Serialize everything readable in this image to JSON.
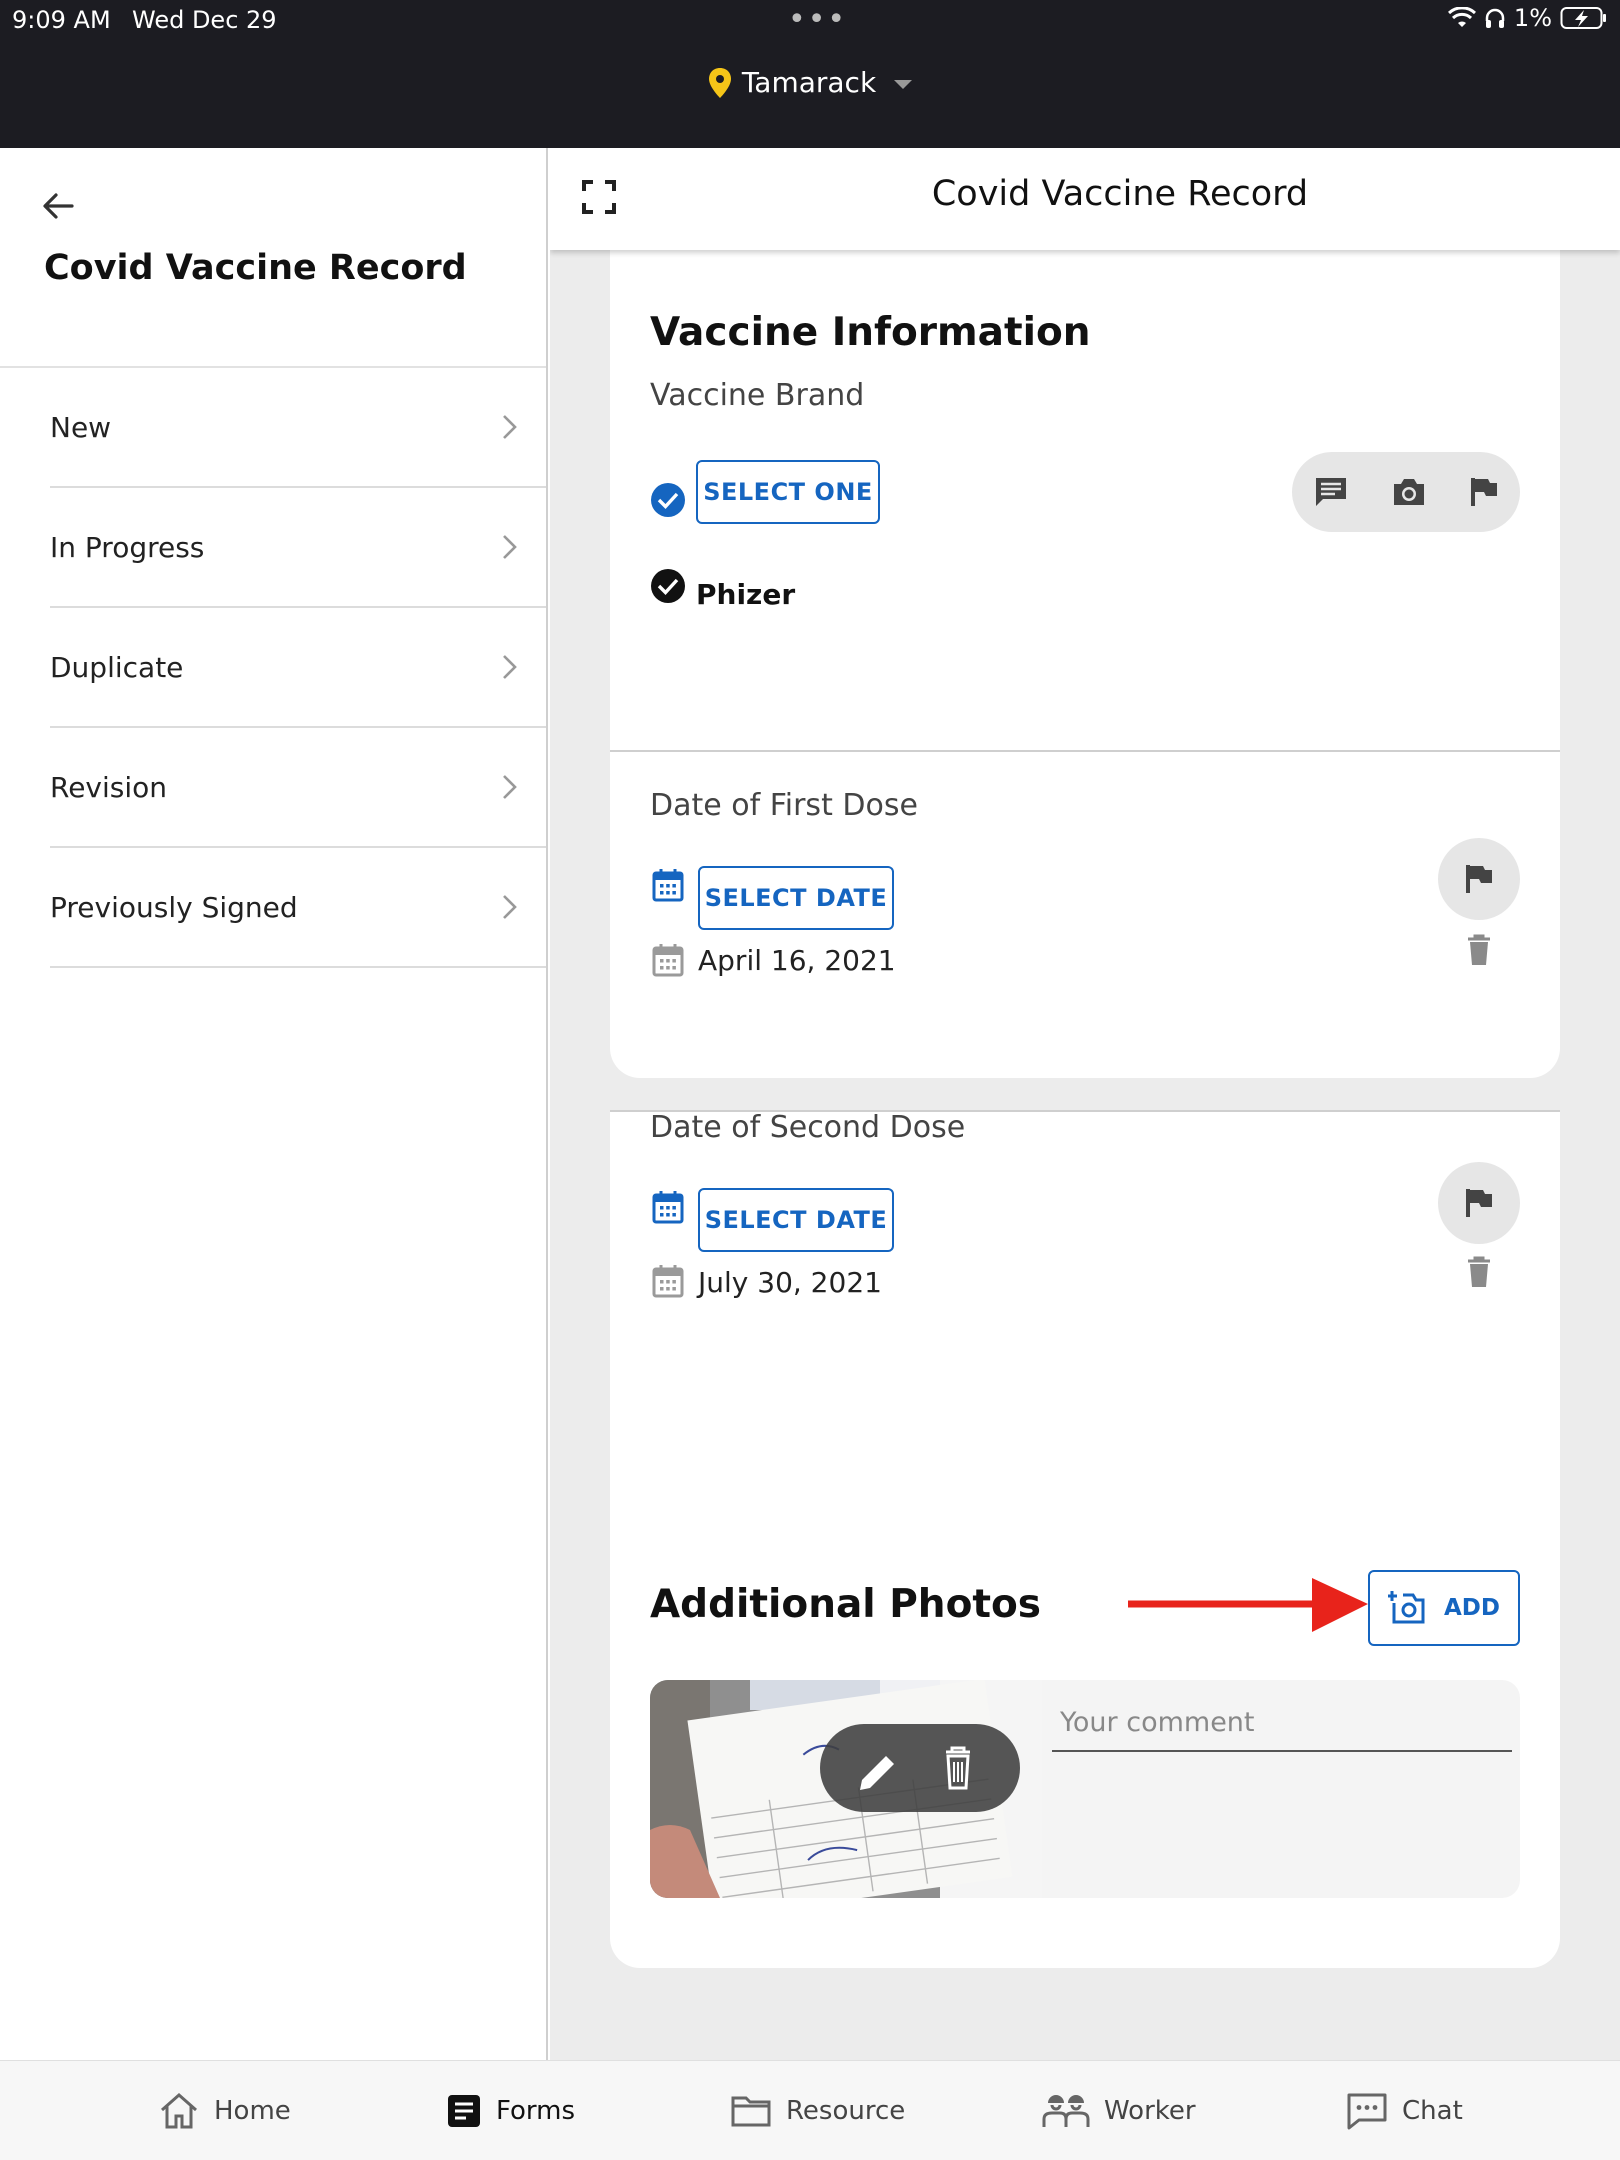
{
  "status": {
    "time": "9:09 AM",
    "date": "Wed Dec 29",
    "battery": "1%"
  },
  "header": {
    "location": "Tamarack"
  },
  "sidebar": {
    "title": "Covid Vaccine Record",
    "items": [
      {
        "label": "New"
      },
      {
        "label": "In Progress"
      },
      {
        "label": "Duplicate"
      },
      {
        "label": "Revision"
      },
      {
        "label": "Previously Signed"
      }
    ]
  },
  "form": {
    "title": "Covid Vaccine Record",
    "vaccine_section": {
      "title": "Vaccine Information",
      "brand_label": "Vaccine Brand",
      "select_one_label": "SELECT ONE",
      "brand_value": "Phizer"
    },
    "first_dose": {
      "label": "Date of First Dose",
      "select_date_label": "SELECT DATE",
      "value": "April 16, 2021"
    },
    "second_dose": {
      "label": "Date of Second Dose",
      "select_date_label": "SELECT DATE",
      "value": "July 30, 2021"
    },
    "photos": {
      "title": "Additional Photos",
      "add_label": "ADD",
      "comment_placeholder": "Your comment"
    }
  },
  "tabbar": {
    "items": [
      {
        "label": "Home"
      },
      {
        "label": "Forms"
      },
      {
        "label": "Resource"
      },
      {
        "label": "Worker"
      },
      {
        "label": "Chat"
      }
    ],
    "active": "Forms"
  },
  "colors": {
    "accent": "#1565c0",
    "annotation_arrow": "#e8231b",
    "location_pin": "#f5c518",
    "topbar": "#1c1c22"
  }
}
